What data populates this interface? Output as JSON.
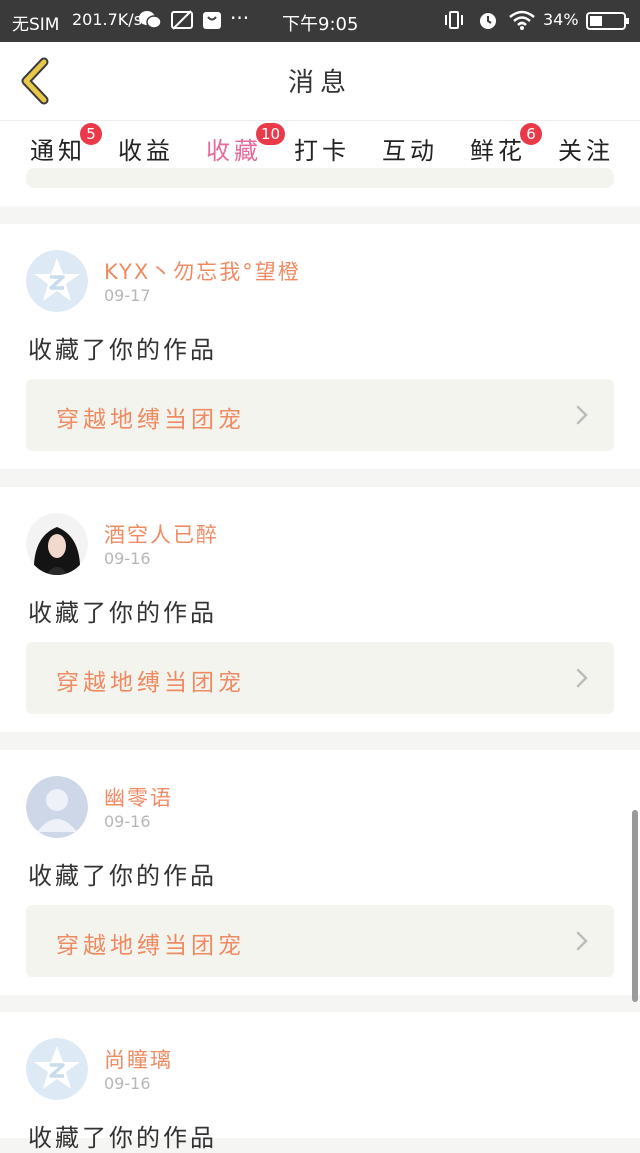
{
  "status_bar": {
    "carrier": "无SIM",
    "speed": "201.7K/s",
    "time": "下午9:05",
    "battery": "34%",
    "more": "···"
  },
  "header": {
    "title": "消息"
  },
  "tabs": [
    {
      "label": "通知",
      "badge": "5",
      "active": false
    },
    {
      "label": "收益",
      "badge": null,
      "active": false
    },
    {
      "label": "收藏",
      "badge": "10",
      "active": true
    },
    {
      "label": "打卡",
      "badge": null,
      "active": false
    },
    {
      "label": "互动",
      "badge": null,
      "active": false
    },
    {
      "label": "鲜花",
      "badge": "6",
      "active": false
    },
    {
      "label": "关注",
      "badge": null,
      "active": false
    }
  ],
  "messages": [
    {
      "user": "KYX丶勿忘我°望橙",
      "date": "09-17",
      "action": "收藏了你的作品",
      "work_title": "穿越地缚当团宠",
      "avatar": "qq-default-avatar"
    },
    {
      "user": "酒空人已醉",
      "date": "09-16",
      "action": "收藏了你的作品",
      "work_title": "穿越地缚当团宠",
      "avatar": "photo-avatar"
    },
    {
      "user": "幽零语",
      "date": "09-16",
      "action": "收藏了你的作品",
      "work_title": "穿越地缚当团宠",
      "avatar": "person-placeholder-avatar"
    },
    {
      "user": "尚瞳璃",
      "date": "09-16",
      "action": "收藏了你的作品",
      "work_title": "",
      "avatar": "qq-default-avatar"
    }
  ],
  "colors": {
    "accent_pink": "#e86a9a",
    "username_orange": "#ef8b63",
    "badge_red": "#ea3a4a",
    "back_arrow": "#e8c84a"
  }
}
